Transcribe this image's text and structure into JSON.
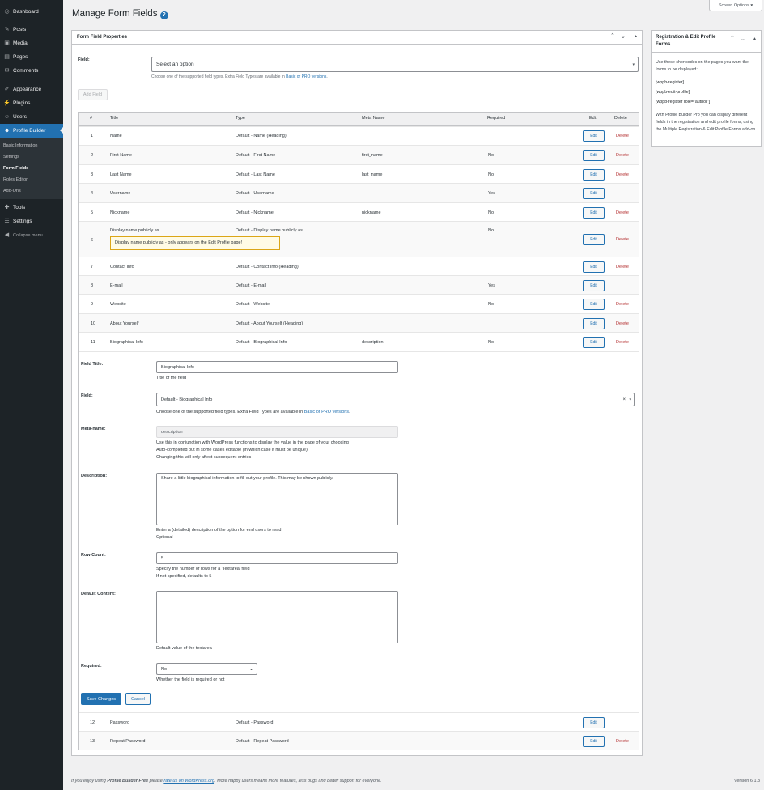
{
  "sidebar": {
    "menu": [
      {
        "label": "Dashboard",
        "icon": "dashboard-icon",
        "glyph": "◎"
      },
      {
        "label": "Posts",
        "icon": "pin-icon",
        "glyph": "✎"
      },
      {
        "label": "Media",
        "icon": "media-icon",
        "glyph": "▣"
      },
      {
        "label": "Pages",
        "icon": "page-icon",
        "glyph": "▤"
      },
      {
        "label": "Comments",
        "icon": "comment-icon",
        "glyph": "✉"
      },
      {
        "label": "Appearance",
        "icon": "brush-icon",
        "glyph": "✐"
      },
      {
        "label": "Plugins",
        "icon": "plug-icon",
        "glyph": "⚡"
      },
      {
        "label": "Users",
        "icon": "users-icon",
        "glyph": "☺"
      },
      {
        "label": "Profile Builder",
        "icon": "profile-icon",
        "glyph": "☻"
      },
      {
        "label": "Tools",
        "icon": "wrench-icon",
        "glyph": "✚"
      },
      {
        "label": "Settings",
        "icon": "settings-icon",
        "glyph": "☰"
      },
      {
        "label": "Collapse menu",
        "icon": "collapse-icon",
        "glyph": "◀"
      }
    ],
    "submenu": [
      "Basic Information",
      "Settings",
      "Form Fields",
      "Roles Editor",
      "Add-Ons"
    ]
  },
  "header": {
    "title": "Manage Form Fields",
    "help": "?",
    "screen_options": "Screen Options ▾"
  },
  "main_box": {
    "title": "Form Field Properties",
    "field_label": "Field:",
    "field_placeholder": "Select an option",
    "field_hint_prefix": "Choose one of the supported field types. Extra Field Types are available in ",
    "field_hint_link": "Basic or PRO versions",
    "field_hint_suffix": ".",
    "add_field": "Add Field"
  },
  "table": {
    "headers": {
      "num": "#",
      "title": "Title",
      "type": "Type",
      "meta": "Meta Name",
      "required": "Required",
      "edit": "Edit",
      "delete": "Delete"
    },
    "rows": [
      {
        "n": "1",
        "title": "Name",
        "type": "Default - Name (Heading)",
        "meta": "",
        "req": "",
        "edit": "Edit",
        "del": "Delete"
      },
      {
        "n": "2",
        "title": "First Name",
        "type": "Default - First Name",
        "meta": "first_name",
        "req": "No",
        "edit": "Edit",
        "del": "Delete"
      },
      {
        "n": "3",
        "title": "Last Name",
        "type": "Default - Last Name",
        "meta": "last_name",
        "req": "No",
        "edit": "Edit",
        "del": "Delete"
      },
      {
        "n": "4",
        "title": "Username",
        "type": "Default - Username",
        "meta": "",
        "req": "Yes",
        "edit": "Edit",
        "del": ""
      },
      {
        "n": "5",
        "title": "Nickname",
        "type": "Default - Nickname",
        "meta": "nickname",
        "req": "No",
        "edit": "Edit",
        "del": "Delete"
      },
      {
        "n": "6",
        "title": "Display name publicly as",
        "type": "Default - Display name publicly as",
        "meta": "",
        "req": "No",
        "edit": "Edit",
        "del": "Delete",
        "note": "Display name publicly as - only appears on the Edit Profile page!"
      },
      {
        "n": "7",
        "title": "Contact Info",
        "type": "Default - Contact Info (Heading)",
        "meta": "",
        "req": "",
        "edit": "Edit",
        "del": "Delete"
      },
      {
        "n": "8",
        "title": "E-mail",
        "type": "Default - E-mail",
        "meta": "",
        "req": "Yes",
        "edit": "Edit",
        "del": ""
      },
      {
        "n": "9",
        "title": "Website",
        "type": "Default - Website",
        "meta": "",
        "req": "No",
        "edit": "Edit",
        "del": "Delete"
      },
      {
        "n": "10",
        "title": "About Yourself",
        "type": "Default - About Yourself (Heading)",
        "meta": "",
        "req": "",
        "edit": "Edit",
        "del": "Delete"
      },
      {
        "n": "11",
        "title": "Biographical Info",
        "type": "Default - Biographical Info",
        "meta": "description",
        "req": "No",
        "edit": "Edit",
        "del": "Delete"
      }
    ],
    "rows_after": [
      {
        "n": "12",
        "title": "Password",
        "type": "Default - Password",
        "meta": "",
        "req": "",
        "edit": "Edit",
        "del": ""
      },
      {
        "n": "13",
        "title": "Repeat Password",
        "type": "Default - Repeat Password",
        "meta": "",
        "req": "",
        "edit": "Edit",
        "del": "Delete"
      }
    ]
  },
  "edit_form": {
    "title_label": "Field Title:",
    "title_value": "Biographical Info",
    "title_hint": "Title of the field",
    "field_label": "Field:",
    "field_value": "Default - Biographical Info",
    "field_clear": "×",
    "field_arrow": "▾",
    "field_hint_prefix": "Choose one of the supported field types. Extra Field Types are available in ",
    "field_hint_link": "Basic or PRO versions",
    "field_hint_suffix": ".",
    "meta_label": "Meta-name:",
    "meta_value": "description",
    "meta_hint1": "Use this in conjunction with WordPress functions to display the value in the page of your choosing",
    "meta_hint2": "Auto-completed but in some cases editable (in which case it must be unique)",
    "meta_hint3": "Changing this will only affect subsequent entries",
    "desc_label": "Description:",
    "desc_value": "Share a little biographical information to fill out your profile. This may be shown publicly.",
    "desc_hint1": "Enter a (detailed) description of the option for end users to read",
    "desc_hint2": "Optional",
    "rows_label": "Row Count:",
    "rows_value": "5",
    "rows_hint1": "Specify the number of rows for a 'Textarea' field",
    "rows_hint2": "If not specified, defaults to 5",
    "default_label": "Default Content:",
    "default_value": "",
    "default_hint": "Default value of the textarea",
    "required_label": "Required:",
    "required_value": "No",
    "required_hint": "Whether the field is required or not",
    "save": "Save Changes",
    "cancel": "Cancel"
  },
  "side_box": {
    "title": "Registration & Edit Profile Forms",
    "intro": "Use these shortcodes on the pages you want the forms to be displayed:",
    "codes": [
      "[wppb-register]",
      "[wppb-edit-profile]",
      "[wppb-register role=\"author\"]"
    ],
    "outro": "With Profile Builder Pro you can display different fields in the registration and edit profile forms, using the Multiple Registration & Edit Profile Forms add-on."
  },
  "footer": {
    "p1": "If you enjoy using ",
    "brand": "Profile Builder Free",
    "p2": " please ",
    "link": "rate us on WordPress.org",
    "p3": ". More happy users means more features, less bugs and better support for everyone.",
    "version": "Version 6.1.3"
  }
}
